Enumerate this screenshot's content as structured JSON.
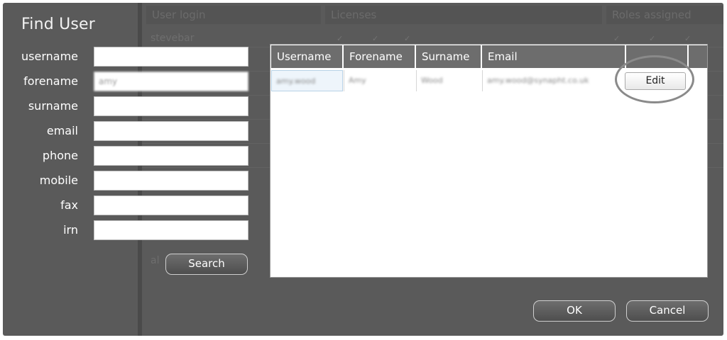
{
  "background_app": {
    "headers": [
      "User login",
      "Licenses",
      "Roles assigned"
    ],
    "row_text": "stevebar",
    "rows_faint": [
      "",
      "",
      "",
      "",
      ""
    ],
    "bottom_text": "al"
  },
  "dialog": {
    "title": "Find User",
    "fields": [
      {
        "label": "username",
        "value": ""
      },
      {
        "label": "forename",
        "value": "amy"
      },
      {
        "label": "surname",
        "value": ""
      },
      {
        "label": "email",
        "value": ""
      },
      {
        "label": "phone",
        "value": ""
      },
      {
        "label": "mobile",
        "value": ""
      },
      {
        "label": "fax",
        "value": ""
      },
      {
        "label": "irn",
        "value": ""
      }
    ],
    "search_label": "Search",
    "ok_label": "OK",
    "cancel_label": "Cancel"
  },
  "results": {
    "columns": [
      "Username",
      "Forename",
      "Surname",
      "Email",
      "",
      ""
    ],
    "rows": [
      {
        "username": "amy.wood",
        "forename": "Amy",
        "surname": "Wood",
        "email": "amy.wood@synapht.co.uk",
        "action_label": "Edit"
      }
    ]
  },
  "colors": {
    "dialog_bg": "#5a5a5a",
    "header_bg": "#6d6d6d",
    "highlight_ring": "#8a8a8a"
  }
}
